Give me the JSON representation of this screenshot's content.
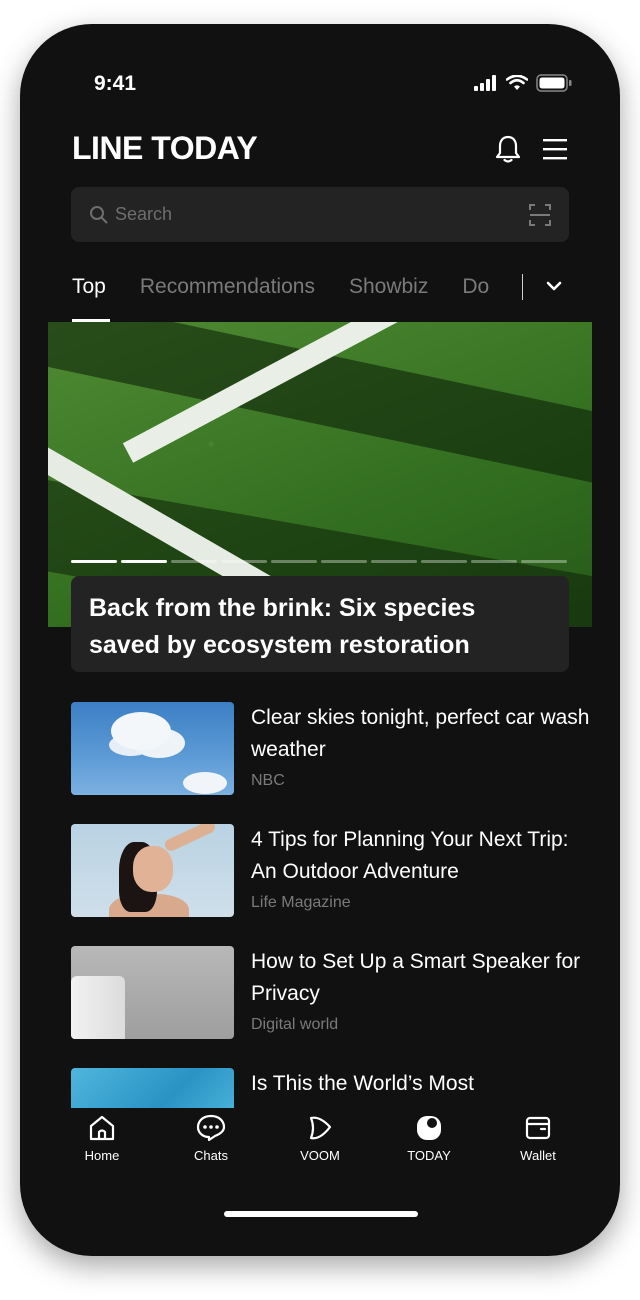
{
  "status_bar": {
    "time": "9:41"
  },
  "header": {
    "logo": "LINE TODAY"
  },
  "search": {
    "placeholder": "Search"
  },
  "tabs": [
    {
      "label": "Top",
      "active": true
    },
    {
      "label": "Recommendations",
      "active": false
    },
    {
      "label": "Showbiz",
      "active": false
    },
    {
      "label": "Do",
      "active": false
    }
  ],
  "hero": {
    "title": "Back from the brink: Six species saved by ecosystem restoration",
    "progress": {
      "current": 2,
      "total": 10
    }
  },
  "articles": [
    {
      "title": "Clear skies tonight, perfect car wash weather",
      "source": "NBC",
      "thumb": "sky-clouds"
    },
    {
      "title": "4 Tips for Planning Your Next Trip: An Outdoor Adventure",
      "source": "Life Magazine",
      "thumb": "woman-sun"
    },
    {
      "title": "How to Set Up a Smart Speaker for Privacy",
      "source": "Digital world",
      "thumb": "smart-speaker"
    },
    {
      "title": "Is This the World’s Most",
      "source": "",
      "thumb": "water"
    }
  ],
  "bottom_nav": [
    {
      "label": "Home",
      "icon": "home-icon"
    },
    {
      "label": "Chats",
      "icon": "chat-icon"
    },
    {
      "label": "VOOM",
      "icon": "voom-icon"
    },
    {
      "label": "TODAY",
      "icon": "today-icon",
      "active": true
    },
    {
      "label": "Wallet",
      "icon": "wallet-icon"
    }
  ],
  "colors": {
    "background": "#111111",
    "surface": "#232323",
    "text": "#ffffff",
    "muted": "#7a7a7a"
  }
}
